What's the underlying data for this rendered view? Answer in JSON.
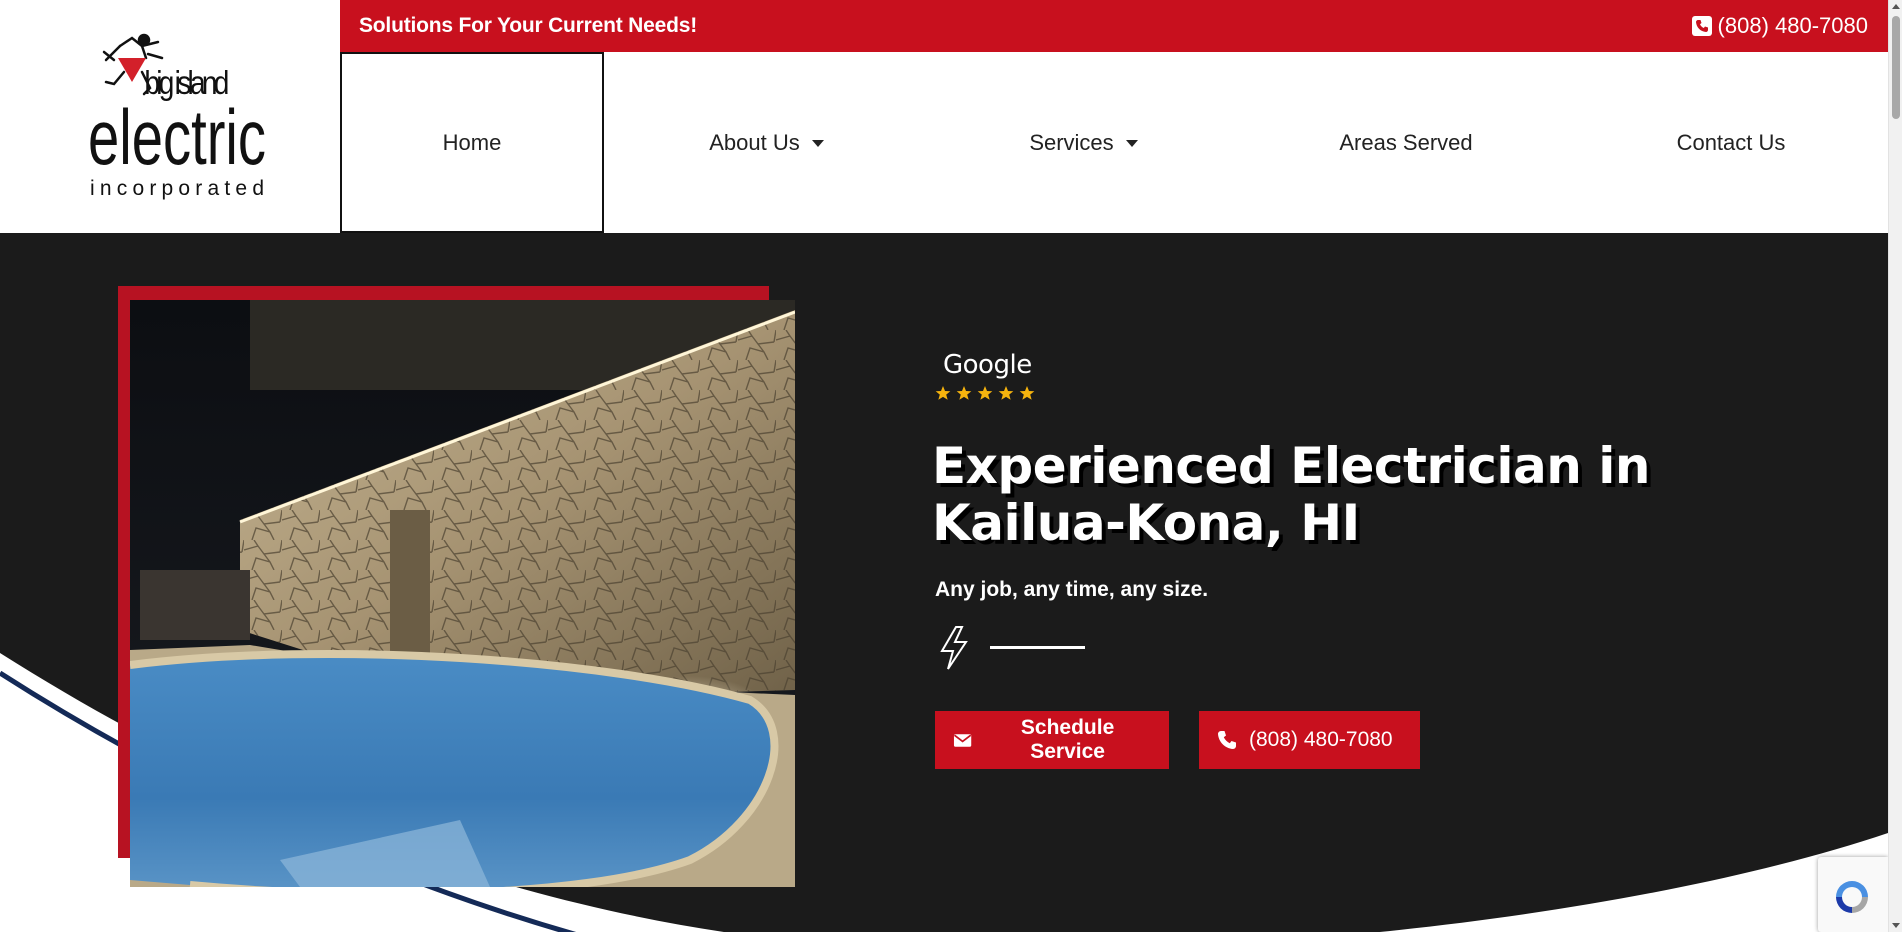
{
  "header": {
    "logo": {
      "line1": "big island",
      "line2": "electric",
      "line3": "incorporated"
    },
    "tagline": "Solutions For Your Current Needs!",
    "phone": "(808) 480-7080",
    "phone_icon": "phone-square-icon"
  },
  "nav": {
    "items": [
      {
        "label": "Home",
        "active": true,
        "has_dropdown": false
      },
      {
        "label": "About Us",
        "active": false,
        "has_dropdown": true
      },
      {
        "label": "Services",
        "active": false,
        "has_dropdown": true
      },
      {
        "label": "Areas Served",
        "active": false,
        "has_dropdown": false
      },
      {
        "label": "Contact Us",
        "active": false,
        "has_dropdown": false
      }
    ]
  },
  "hero": {
    "review_source": "Google",
    "rating_stars": 5,
    "title": "Experienced Electrician in Kailua-Kona, HI",
    "subtitle": "Any job, any time, any size.",
    "divider_icon": "lightning-bolt-icon",
    "buttons": {
      "schedule_label": "Schedule Service",
      "schedule_icon": "envelope-icon",
      "call_label": "(808) 480-7080",
      "call_icon": "phone-icon"
    },
    "image_alt": "illuminated stone wall beside a pool at night"
  },
  "colors": {
    "brand_red": "#c8101e",
    "frame_red": "#b71222",
    "hero_bg": "#1b1b1b",
    "star_gold": "#f6b40e",
    "curve_navy": "#142a57"
  }
}
